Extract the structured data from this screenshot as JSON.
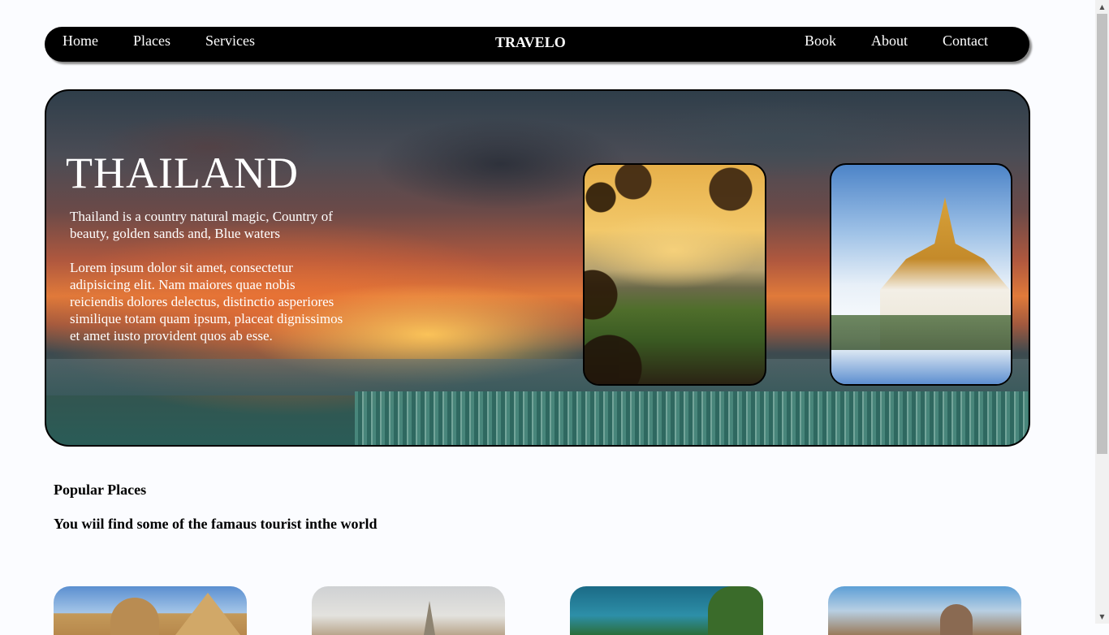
{
  "nav": {
    "left_links": [
      "Home",
      "Places",
      "Services"
    ],
    "brand": "TRAVELO",
    "right_links": [
      "Book",
      "About",
      "Contact"
    ]
  },
  "hero": {
    "title": "THAILAND",
    "desc_1": "Thailand is a country natural magic, Country of beauty, golden sands and, Blue waters",
    "desc_2": "Lorem ipsum dolor sit amet, consectetur adipisicing elit. Nam maiores quae nobis reiciendis dolores delectus, distinctio asperiores similique totam quam ipsum, placeat dignissimos et amet iusto provident quos ab esse."
  },
  "popular": {
    "title": "Popular Places",
    "subtitle": "You wiil find some of the famaus tourist inthe world"
  },
  "icons": {
    "scroll_up": "scroll-up-arrow-icon",
    "scroll_down": "scroll-down-arrow-icon"
  },
  "colors": {
    "nav_bg": "#000000",
    "page_bg": "#fbfcff",
    "text": "#000000"
  }
}
